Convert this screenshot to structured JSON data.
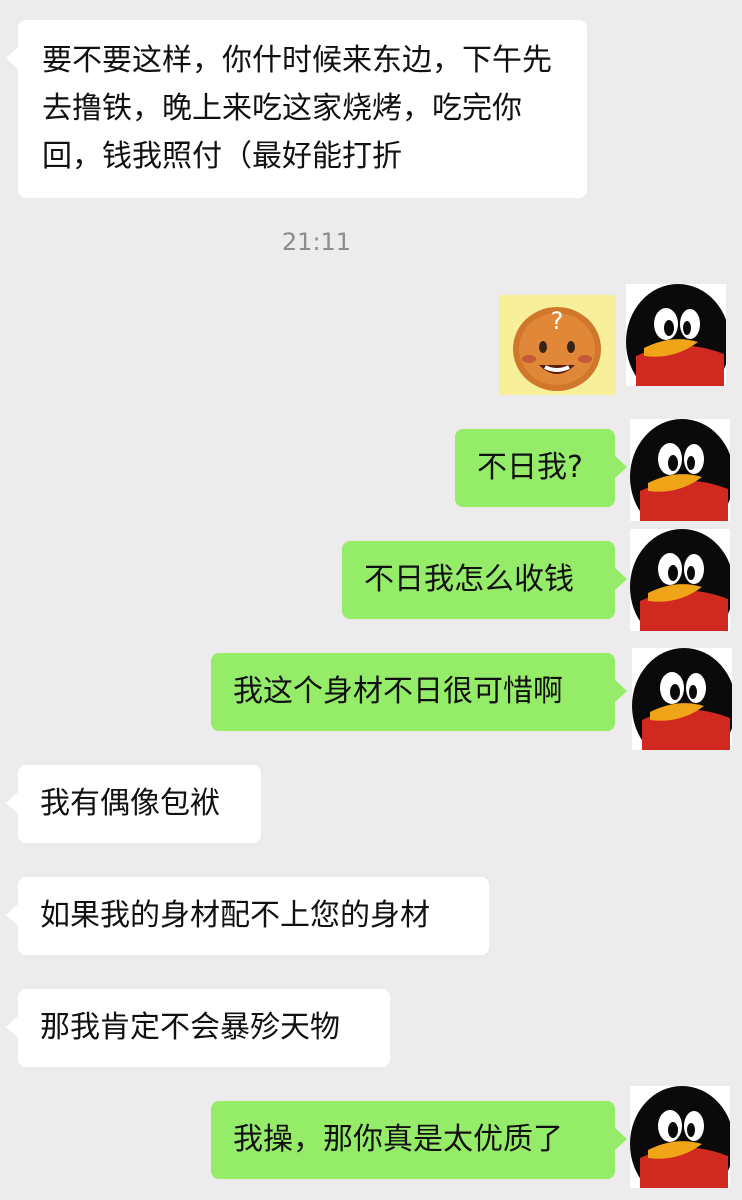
{
  "messages": [
    {
      "side": "in",
      "type": "text",
      "text": "要不要这样，你什时候来东边，下午先去撸铁，晚上来吃这家烧烤，吃完你回，钱我照付（最好能打折"
    },
    {
      "type": "timestamp",
      "text": "21:11"
    },
    {
      "side": "out",
      "type": "sticker",
      "sticker": "confused-pancake-face-sticker",
      "sticker_text": "?"
    },
    {
      "side": "out",
      "type": "text",
      "text": "不日我?"
    },
    {
      "side": "out",
      "type": "text",
      "text": "不日我怎么收钱"
    },
    {
      "side": "out",
      "type": "text",
      "text": "我这个身材不日很可惜啊"
    },
    {
      "side": "in",
      "type": "text",
      "text": "我有偶像包袱"
    },
    {
      "side": "in",
      "type": "text",
      "text": "如果我的身材配不上您的身材"
    },
    {
      "side": "in",
      "type": "text",
      "text": "那我肯定不会暴殄天物"
    },
    {
      "side": "out",
      "type": "text",
      "text": "我操，那你真是太优质了"
    }
  ],
  "colors": {
    "background": "#ececec",
    "incoming_bubble": "#ffffff",
    "outgoing_bubble": "#95ec69",
    "timestamp_text": "#8c8c8c"
  },
  "avatar": {
    "icon": "qq-penguin-avatar-icon"
  }
}
